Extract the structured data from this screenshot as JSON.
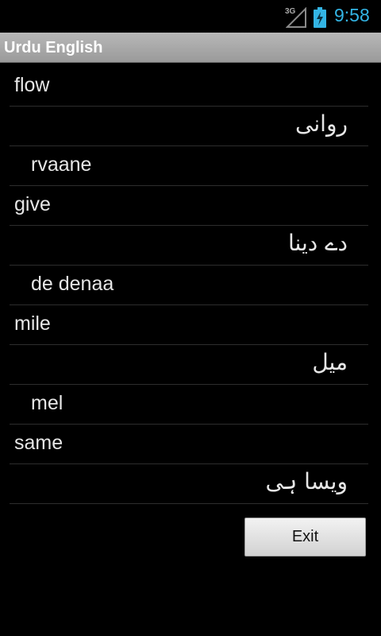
{
  "status_bar": {
    "network_label": "3G",
    "time": "9:58",
    "signal_icon": "signal-icon",
    "battery_icon": "battery-charging-icon",
    "accent_color": "#33b5e5"
  },
  "app": {
    "title": "Urdu English"
  },
  "entries": [
    {
      "english": "flow",
      "urdu": "روانی",
      "transliteration": "rvaane"
    },
    {
      "english": "give",
      "urdu": "دے دینا",
      "transliteration": "de denaa"
    },
    {
      "english": "mile",
      "urdu": "میل",
      "transliteration": "mel"
    },
    {
      "english": "same",
      "urdu": "ویسا ہی"
    }
  ],
  "actions": {
    "exit_label": "Exit"
  }
}
